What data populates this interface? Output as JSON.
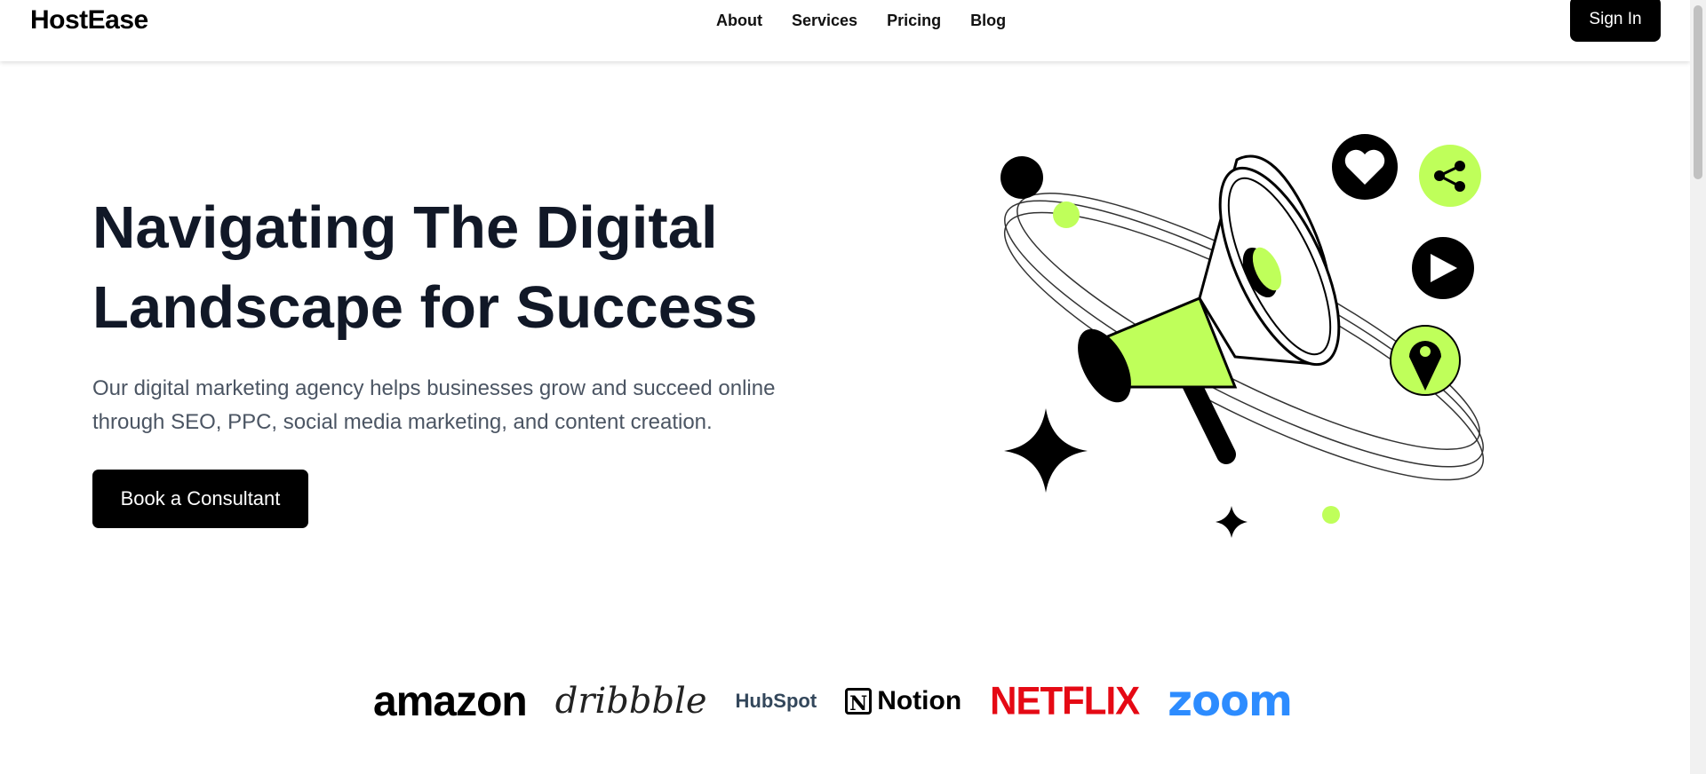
{
  "header": {
    "brand": "HostEase",
    "nav": [
      {
        "label": "About"
      },
      {
        "label": "Services"
      },
      {
        "label": "Pricing"
      },
      {
        "label": "Blog"
      }
    ],
    "signin_label": "Sign In"
  },
  "hero": {
    "title": "Navigating The Digital Landscape for Success",
    "description": "Our digital marketing agency helps businesses grow and succeed online through SEO, PPC, social media marketing, and content creation.",
    "cta_label": "Book a Consultant",
    "illustration_icons": [
      "megaphone-icon",
      "heart-icon",
      "share-icon",
      "play-icon",
      "location-pin-icon",
      "sparkle-star-icon"
    ],
    "accent_color": "#bfff5a"
  },
  "logos": {
    "amazon": "amazon",
    "dribbble": "dribbble",
    "hubspot": "HubSpot",
    "notion": "Notion",
    "notion_mark": "N",
    "netflix": "NETFLIX",
    "zoom": "zoom"
  },
  "colors": {
    "primary_button": "#000000",
    "heading": "#111827",
    "body_text": "#4b5563",
    "netflix_red": "#e50914",
    "zoom_blue": "#2d8cff",
    "hubspot_navy": "#33475b"
  }
}
